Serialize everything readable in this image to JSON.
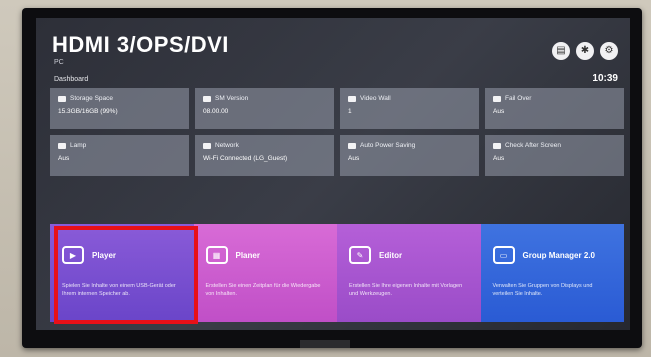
{
  "header": {
    "title": "HDMI 3/OPS/DVI",
    "subtitle": "PC",
    "section": "Dashboard",
    "time": "10:39"
  },
  "top_icons": [
    {
      "name": "book-icon",
      "glyph": "▤"
    },
    {
      "name": "settings-icon",
      "glyph": "✱"
    },
    {
      "name": "gear-icon",
      "glyph": "⚙"
    }
  ],
  "info_tiles": [
    {
      "label": "Storage Space",
      "value": "15.3GB/16GB  (99%)"
    },
    {
      "label": "SM Version",
      "value": "08.00.00"
    },
    {
      "label": "Video Wall",
      "value": "1"
    },
    {
      "label": "Fail Over",
      "value": "Aus"
    },
    {
      "label": "Lamp",
      "value": "Aus"
    },
    {
      "label": "Network",
      "value": "Wi-Fi Connected (LG_Guest)"
    },
    {
      "label": "Auto Power Saving",
      "value": "Aus"
    },
    {
      "label": "Check After Screen",
      "value": "Aus"
    }
  ],
  "apps": [
    {
      "name": "Player",
      "desc": "Spielen Sie Inhalte von einem USB-Gerät oder Ihrem internen Speicher ab."
    },
    {
      "name": "Planer",
      "desc": "Erstellen Sie einen Zeitplan für die Wiedergabe von Inhalten."
    },
    {
      "name": "Editor",
      "desc": "Erstellen Sie Ihre eigenen Inhalte mit Vorlagen und Werkzeugen."
    },
    {
      "name": "Group Manager 2.0",
      "desc": "Verwalten Sie Gruppen von Displays und verteilen Sie Inhalte."
    }
  ]
}
